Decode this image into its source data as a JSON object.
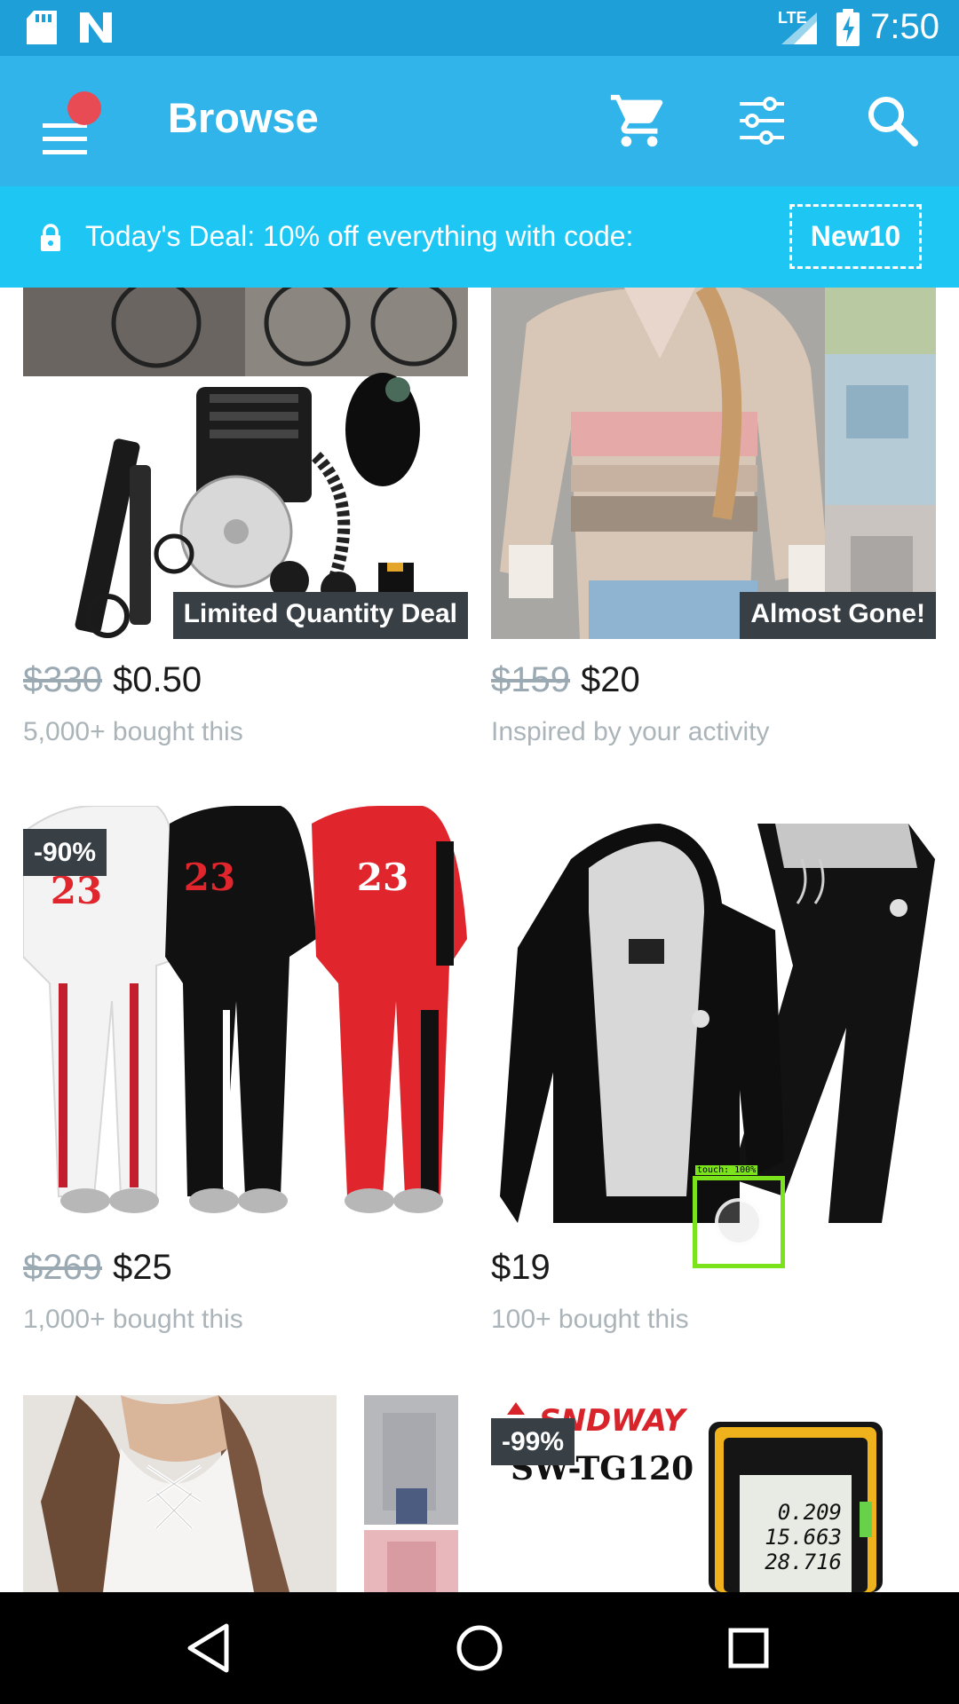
{
  "status_bar": {
    "time": "7:50",
    "network_label": "LTE",
    "icons": [
      "sd-card-icon",
      "n-notification-icon",
      "signal-icon",
      "battery-charging-icon"
    ]
  },
  "app_bar": {
    "title": "Browse",
    "icons": [
      "menu-icon",
      "cart-icon",
      "filter-icon",
      "search-icon"
    ],
    "notification_dot_color": "#e94b55"
  },
  "deal_banner": {
    "text": "Today's Deal: 10% off everything with code:",
    "code": "New10",
    "icon": "lock-icon"
  },
  "products": [
    {
      "badge": "Limited Quantity Deal",
      "old_price": "$330",
      "price": "$0.50",
      "subtitle": "5,000+ bought this"
    },
    {
      "badge": "Almost Gone!",
      "old_price": "$159",
      "price": "$20",
      "subtitle": "Inspired by your activity"
    },
    {
      "discount": "-90%",
      "old_price": "$269",
      "price": "$25",
      "subtitle": "1,000+ bought this"
    },
    {
      "price": "$19",
      "subtitle": "100+ bought this"
    },
    {
      "image": "white lace-up sweater"
    },
    {
      "discount": "-99%",
      "brand_text": "SNDWAY",
      "model_text": "SW-TG120",
      "display_readings": [
        "0.209",
        "15.663",
        "28.716"
      ]
    }
  ],
  "touch_indicator": {
    "label": "touch: 100%"
  },
  "nav_bar": {
    "icons": [
      "back-icon",
      "home-icon",
      "recents-icon"
    ]
  },
  "colors": {
    "status_bar": "#1e9fd8",
    "app_bar": "#30b4ea",
    "deal_banner": "#1ec6f4",
    "badge": "#384045"
  }
}
